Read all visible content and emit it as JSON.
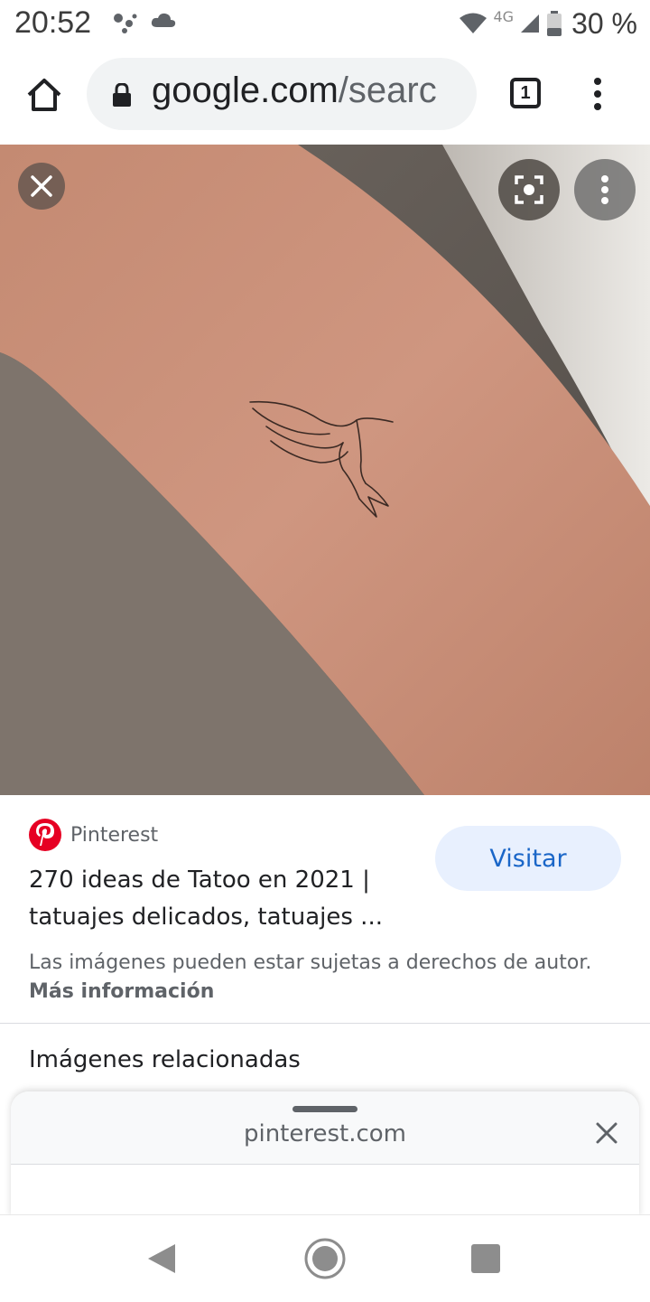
{
  "status_bar": {
    "time": "20:52",
    "network": "4G",
    "battery": "30 %"
  },
  "browser": {
    "url_host": "google.com",
    "url_path": "/searc",
    "tab_count": "1"
  },
  "result": {
    "source": "Pinterest",
    "title": "270 ideas de Tatoo en 2021 | tatuajes delicados, tatuajes ...",
    "visit_label": "Visitar",
    "copyright_text": "Las imágenes pueden estar sujetas a derechos de autor.",
    "more_info_label": "Más información",
    "related_heading": "Imágenes relacionadas"
  },
  "sheet": {
    "domain": "pinterest.com"
  },
  "icons": {
    "home": "home-icon",
    "lock": "lock-icon",
    "tabs": "tabs-icon",
    "menu": "more-vert-icon",
    "close": "close-icon",
    "lens": "lens-icon",
    "pinterest": "pinterest-logo-icon",
    "back": "back-icon",
    "nav_home": "nav-home-icon",
    "recent": "recent-apps-icon"
  },
  "colors": {
    "accent": "#1a66c8",
    "visit_bg": "#e8f0fe",
    "pinterest": "#e60023"
  }
}
